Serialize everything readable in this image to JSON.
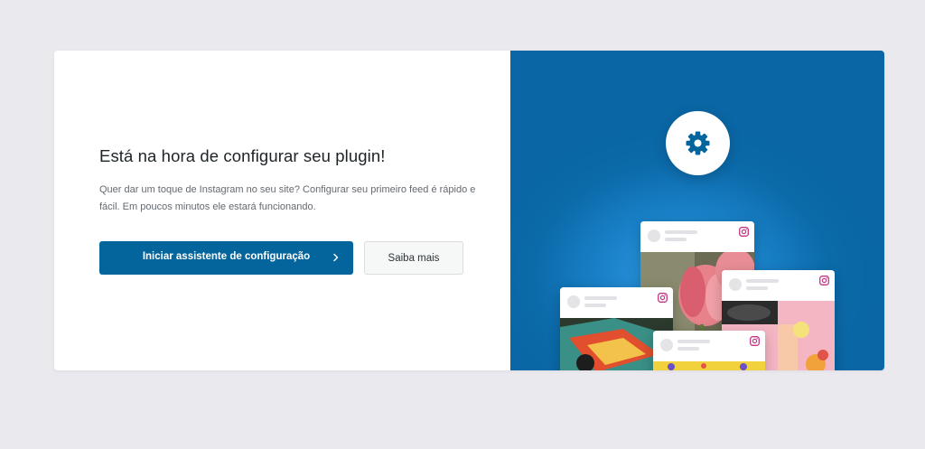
{
  "setup": {
    "title": "Está na hora de configurar seu plugin!",
    "description": "Quer dar um toque de Instagram no seu site? Configurar seu primeiro feed é rápido e fácil. Em poucos minutos ele estará funcionando.",
    "primary_button": "Iniciar assistente de configuração",
    "secondary_button": "Saiba mais"
  },
  "illustration": {
    "icons": [
      "gear-icon",
      "instagram-icon",
      "chevron-right-icon"
    ],
    "colors": {
      "panel": "#0b6aa9",
      "accent_button": "#04659c",
      "instagram": "#c13584"
    }
  }
}
